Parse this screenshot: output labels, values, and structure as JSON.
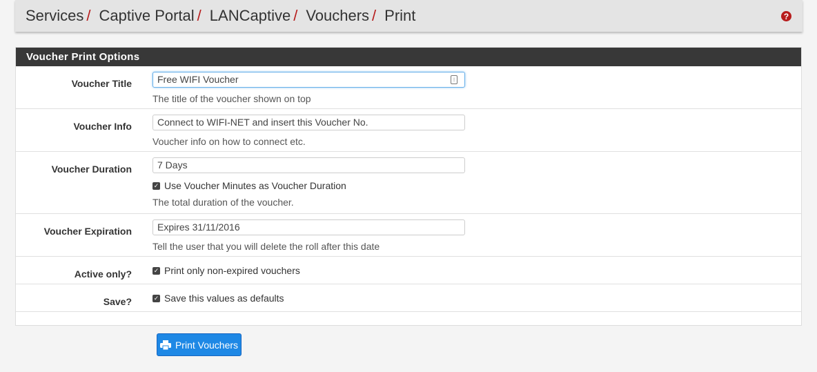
{
  "breadcrumb": {
    "items": [
      "Services",
      "Captive Portal",
      "LANCaptive",
      "Vouchers",
      "Print"
    ],
    "separator": "/"
  },
  "help_icon": "?",
  "panel": {
    "title": "Voucher Print Options"
  },
  "fields": {
    "title": {
      "label": "Voucher Title",
      "value": "Free WIFI Voucher",
      "help": "The title of the voucher shown on top"
    },
    "info": {
      "label": "Voucher Info",
      "value": "Connect to WIFI-NET and insert this Voucher No.",
      "help": "Voucher info on how to connect etc."
    },
    "duration": {
      "label": "Voucher Duration",
      "value": "7 Days",
      "checkbox_label": "Use Voucher Minutes as Voucher Duration",
      "help": "The total duration of the voucher."
    },
    "expiration": {
      "label": "Voucher Expiration",
      "value": "Expires 31/11/2016",
      "help": "Tell the user that you will delete the roll after this date"
    },
    "active_only": {
      "label": "Active only?",
      "checkbox_label": "Print only non-expired vouchers"
    },
    "save": {
      "label": "Save?",
      "checkbox_label": "Save this values as defaults"
    }
  },
  "button": {
    "label": "Print Vouchers",
    "icon": "printer-icon"
  },
  "colors": {
    "accent_red": "#b71c1c",
    "button_blue": "#1e88e5",
    "panel_heading": "#383838"
  }
}
